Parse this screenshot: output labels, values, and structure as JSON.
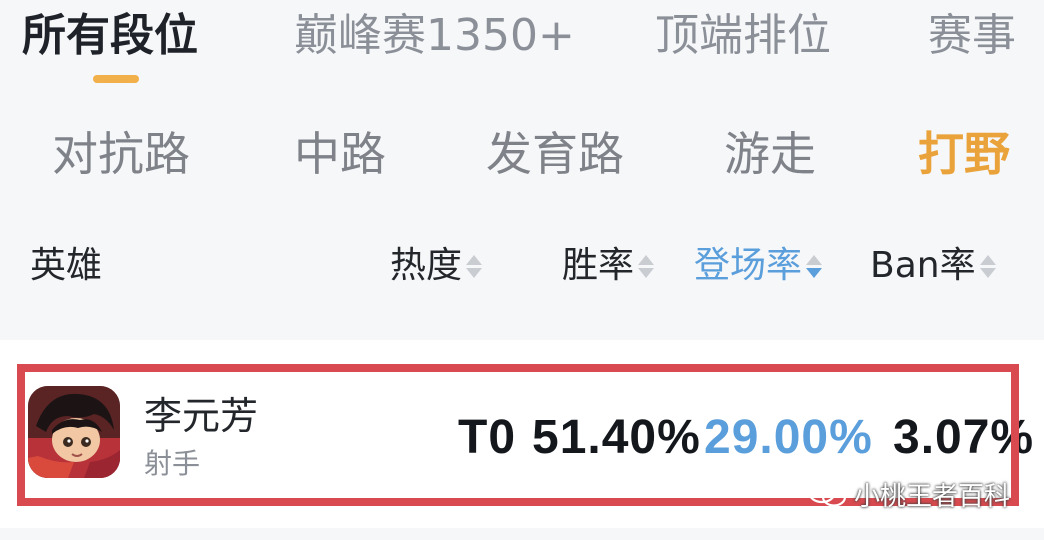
{
  "tabs": [
    {
      "label": "所有段位",
      "active": true
    },
    {
      "label": "巅峰赛1350+",
      "active": false
    },
    {
      "label": "顶端排位",
      "active": false
    },
    {
      "label": "赛事",
      "active": false
    }
  ],
  "roles": [
    {
      "label": "对抗路",
      "active": false
    },
    {
      "label": "中路",
      "active": false
    },
    {
      "label": "发育路",
      "active": false
    },
    {
      "label": "游走",
      "active": false
    },
    {
      "label": "打野",
      "active": true
    }
  ],
  "table": {
    "columns": {
      "hero": "英雄",
      "heat": "热度",
      "win_rate": "胜率",
      "pick_rate": "登场率",
      "ban_rate": "Ban率"
    },
    "sorted_by": "pick_rate",
    "sort_direction": "desc",
    "rows": [
      {
        "name": "李元芳",
        "role": "射手",
        "tier": "T0",
        "win_rate": "51.40%",
        "pick_rate": "29.00%",
        "ban_rate": "3.07%"
      }
    ]
  },
  "watermark": {
    "text": "小桃王者百科",
    "icon": "wechat-icon"
  },
  "colors": {
    "accent_orange": "#eaa23a",
    "accent_blue": "#5a9edb",
    "highlight_red": "#d84a4f"
  }
}
